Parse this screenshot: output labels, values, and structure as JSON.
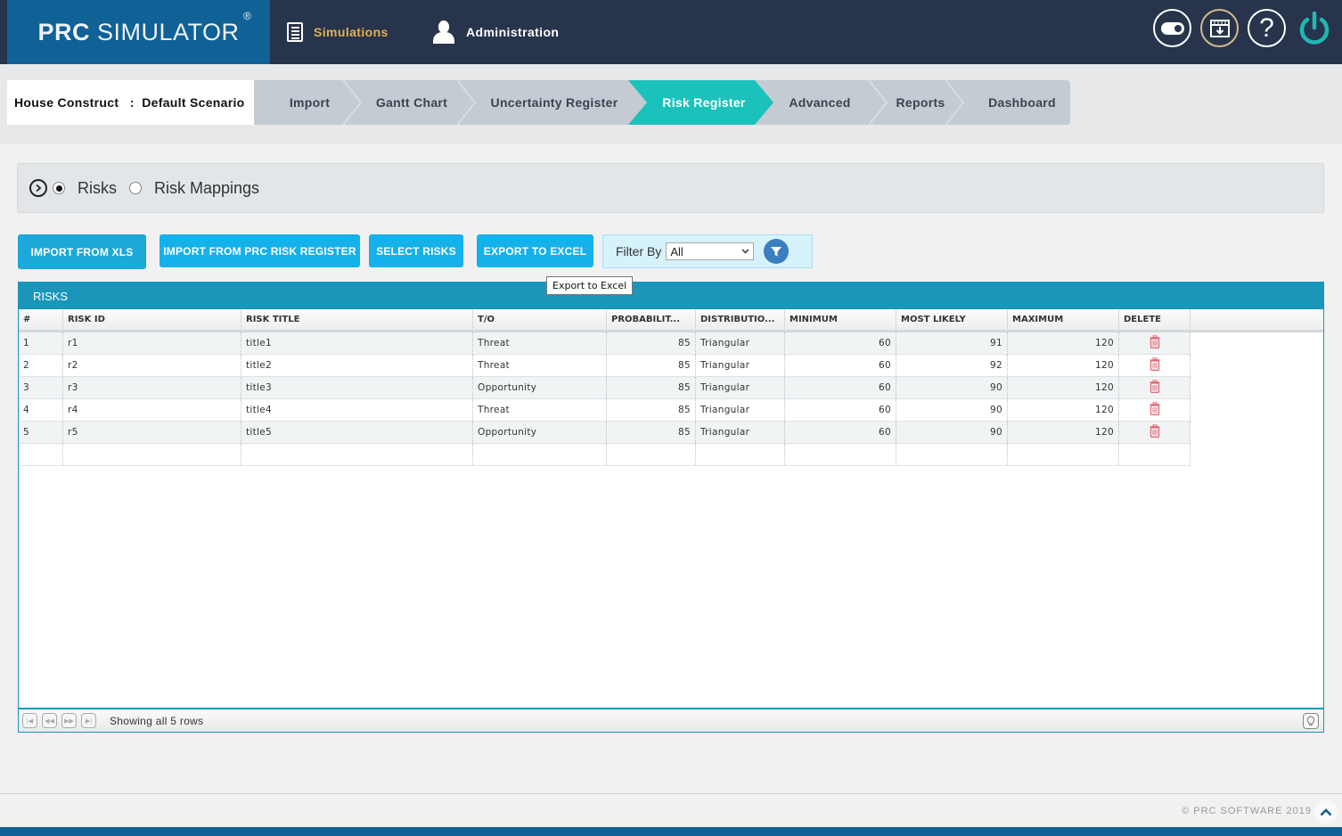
{
  "app": {
    "logo_bold": "PRC",
    "logo_rest": " SIMULATOR",
    "logo_reg": "®"
  },
  "nav": {
    "simulations": "Simulations",
    "administration": "Administration"
  },
  "header_icons": [
    "theme-toggle-icon",
    "download-icon",
    "help-icon",
    "power-icon"
  ],
  "header_help_glyph": "?",
  "project": {
    "name": "House Construct",
    "separator": ":",
    "scenario": "Default Scenario"
  },
  "steps": [
    {
      "label": "Import",
      "active": false
    },
    {
      "label": "Gantt Chart",
      "active": false
    },
    {
      "label": "Uncertainty Register",
      "active": false
    },
    {
      "label": "Risk Register",
      "active": true
    },
    {
      "label": "Advanced",
      "active": false
    },
    {
      "label": "Reports",
      "active": false
    },
    {
      "label": "Dashboard",
      "active": false
    }
  ],
  "view_toggle": {
    "options": [
      {
        "label": "Risks",
        "selected": true
      },
      {
        "label": "Risk Mappings",
        "selected": false
      }
    ]
  },
  "toolbar": {
    "import_xls": "IMPORT FROM XLS",
    "import_prc": "IMPORT FROM PRC RISK REGISTER",
    "select_risks": "SELECT RISKS",
    "export_excel": "EXPORT TO EXCEL",
    "filter_label": "Filter By",
    "filter_value": "All",
    "tooltip": "Export to Excel"
  },
  "grid": {
    "title": "RISKS",
    "columns": [
      "#",
      "RISK ID",
      "RISK TITLE",
      "T/O",
      "PROBABILIT...",
      "DISTRIBUTIO...",
      "MINIMUM",
      "MOST LIKELY",
      "MAXIMUM",
      "DELETE"
    ],
    "rows": [
      {
        "num": "1",
        "risk_id": "r1",
        "title": "title1",
        "to": "Threat",
        "probability": "85",
        "distribution": "Triangular",
        "minimum": "60",
        "most_likely": "91",
        "maximum": "120"
      },
      {
        "num": "2",
        "risk_id": "r2",
        "title": "title2",
        "to": "Threat",
        "probability": "85",
        "distribution": "Triangular",
        "minimum": "60",
        "most_likely": "92",
        "maximum": "120"
      },
      {
        "num": "3",
        "risk_id": "r3",
        "title": "title3",
        "to": "Opportunity",
        "probability": "85",
        "distribution": "Triangular",
        "minimum": "60",
        "most_likely": "90",
        "maximum": "120"
      },
      {
        "num": "4",
        "risk_id": "r4",
        "title": "title4",
        "to": "Threat",
        "probability": "85",
        "distribution": "Triangular",
        "minimum": "60",
        "most_likely": "90",
        "maximum": "120"
      },
      {
        "num": "5",
        "risk_id": "r5",
        "title": "title5",
        "to": "Opportunity",
        "probability": "85",
        "distribution": "Triangular",
        "minimum": "60",
        "most_likely": "90",
        "maximum": "120"
      }
    ],
    "footer_text": "Showing all 5 rows"
  },
  "footer": {
    "copyright": "© PRC SOFTWARE 2019"
  },
  "colors": {
    "header_bg": "#27344b",
    "logo_bg": "#0f6196",
    "active_step": "#1bc2bb",
    "button": "#15b1ea",
    "grid_title": "#1a96bb",
    "delete_icon": "#e06b77",
    "nav_active": "#e3b24f"
  }
}
